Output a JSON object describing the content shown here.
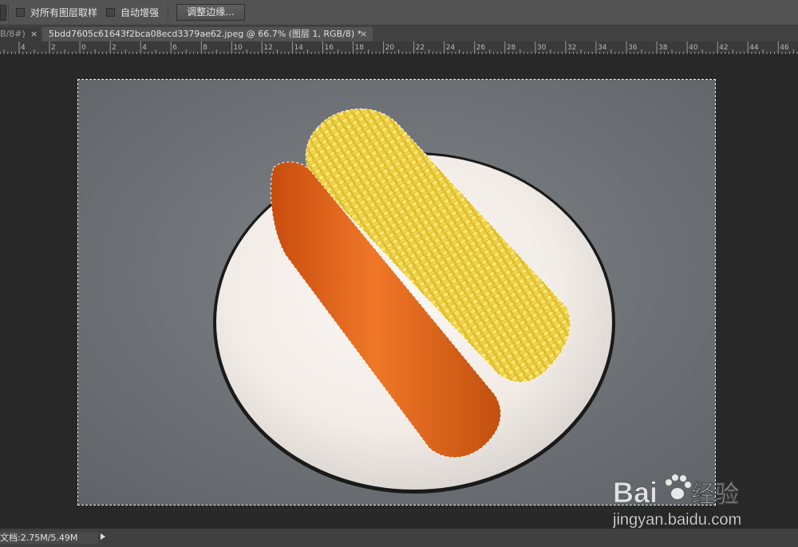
{
  "options_bar": {
    "sample_all_layers_label": "对所有图层取样",
    "auto_enhance_label": "自动增强",
    "refine_edge_label": "调整边缘..."
  },
  "tabs": [
    {
      "label": "B/8#)",
      "close": "×"
    },
    {
      "label": "5bdd7605c61643f2bca08ecd3379ae62.jpeg @ 66.7% (图层 1, RGB/8) *",
      "close": "×"
    }
  ],
  "ruler": {
    "labels": [
      "4",
      "2",
      "0",
      "2",
      "4",
      "6",
      "8",
      "10",
      "12",
      "14",
      "16",
      "18",
      "20",
      "22",
      "24",
      "26",
      "28",
      "30",
      "32",
      "34",
      "36",
      "38",
      "40",
      "42",
      "44",
      "46"
    ]
  },
  "status_bar": {
    "doc_info": "文档:2.75M/5.49M"
  },
  "watermark": {
    "brand": "Bai",
    "brand_tail": "du",
    "jingyan": "经验",
    "url": "jingyan.baidu.com"
  },
  "icons": {
    "paw": "paw-icon",
    "expand": "triangle-right-icon",
    "close": "close-icon"
  }
}
